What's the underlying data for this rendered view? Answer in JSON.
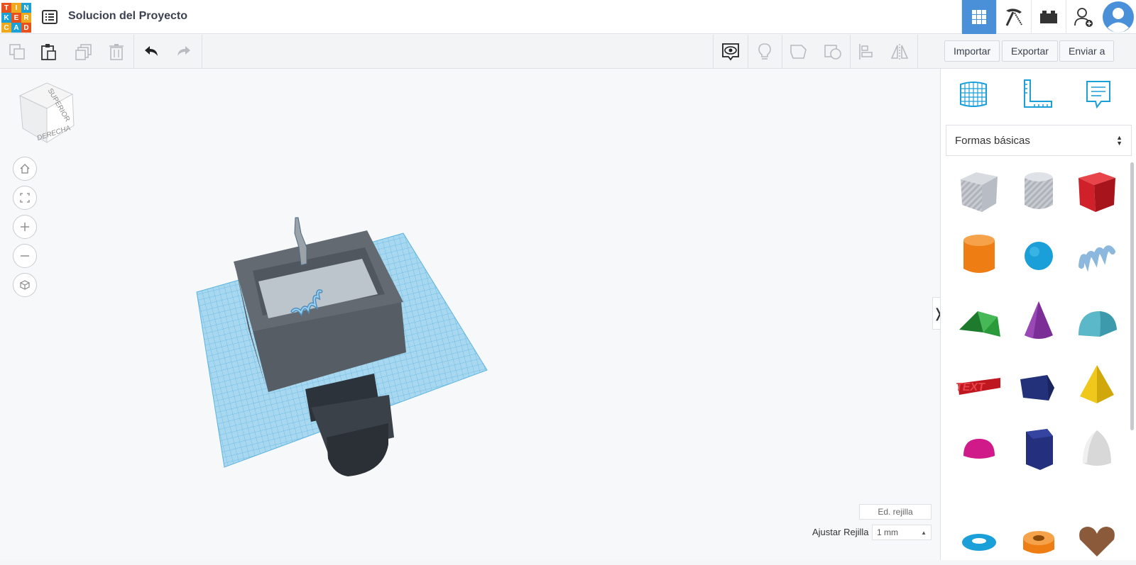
{
  "header": {
    "logo_letters": [
      "T",
      "I",
      "N",
      "K",
      "E",
      "R",
      "C",
      "A",
      "D"
    ],
    "logo_colors": [
      "#e8501c",
      "#f0a81c",
      "#1ca0d8",
      "#1ca0d8",
      "#e8501c",
      "#f0a81c",
      "#f0a81c",
      "#1ca0d8",
      "#e8501c"
    ],
    "project_title": "Solucion del Proyecto",
    "accent": "#4a90d9",
    "buttons": [
      "grid-icon",
      "pickaxe-icon",
      "brick-icon",
      "add-user-icon",
      "avatar-icon"
    ]
  },
  "toolbar": {
    "left_icons": [
      "copy-icon",
      "paste-icon",
      "duplicate-icon",
      "delete-icon",
      "undo-icon",
      "redo-icon"
    ],
    "right_icons": [
      "view-icon",
      "light-icon",
      "group-icon",
      "ungroup-icon",
      "align-icon",
      "mirror-icon"
    ],
    "import_label": "Importar",
    "export_label": "Exportar",
    "send_label": "Enviar a"
  },
  "workplane": {
    "viewcube_top": "SUPERIOR",
    "viewcube_right": "DERECHA",
    "nav_buttons": [
      "home-icon",
      "fit-icon",
      "zoom-in-icon",
      "zoom-out-icon",
      "perspective-icon"
    ],
    "edit_grid_label": "Ed. rejilla",
    "snap_label": "Ajustar Rejilla",
    "snap_value": "1 mm",
    "grid_color": "#a8d8f0"
  },
  "panel": {
    "top_icons": [
      "workplane-icon",
      "ruler-icon",
      "notes-icon"
    ],
    "category": "Formas básicas",
    "shapes": [
      {
        "name": "box-hole",
        "color": "#b8bcc4"
      },
      {
        "name": "cylinder-hole",
        "color": "#c4c8ce"
      },
      {
        "name": "box",
        "color": "#d0202a"
      },
      {
        "name": "cylinder",
        "color": "#ee7d14"
      },
      {
        "name": "sphere",
        "color": "#1a9fd8"
      },
      {
        "name": "scribble",
        "color": "#8cb8de"
      },
      {
        "name": "roof",
        "color": "#2a9a3a"
      },
      {
        "name": "cone",
        "color": "#7b2f96"
      },
      {
        "name": "round-roof",
        "color": "#5ab8c8"
      },
      {
        "name": "text",
        "color": "#c01820"
      },
      {
        "name": "wedge",
        "color": "#23307a"
      },
      {
        "name": "pyramid",
        "color": "#f0c81c"
      },
      {
        "name": "half-sphere",
        "color": "#d01a8a"
      },
      {
        "name": "polygon",
        "color": "#24307e"
      },
      {
        "name": "paraboloid",
        "color": "#d8d8d8"
      },
      {
        "name": "torus",
        "color": "#1a9fd8"
      },
      {
        "name": "tube",
        "color": "#ee7d14"
      },
      {
        "name": "heart",
        "color": "#8a5a3a"
      }
    ]
  }
}
